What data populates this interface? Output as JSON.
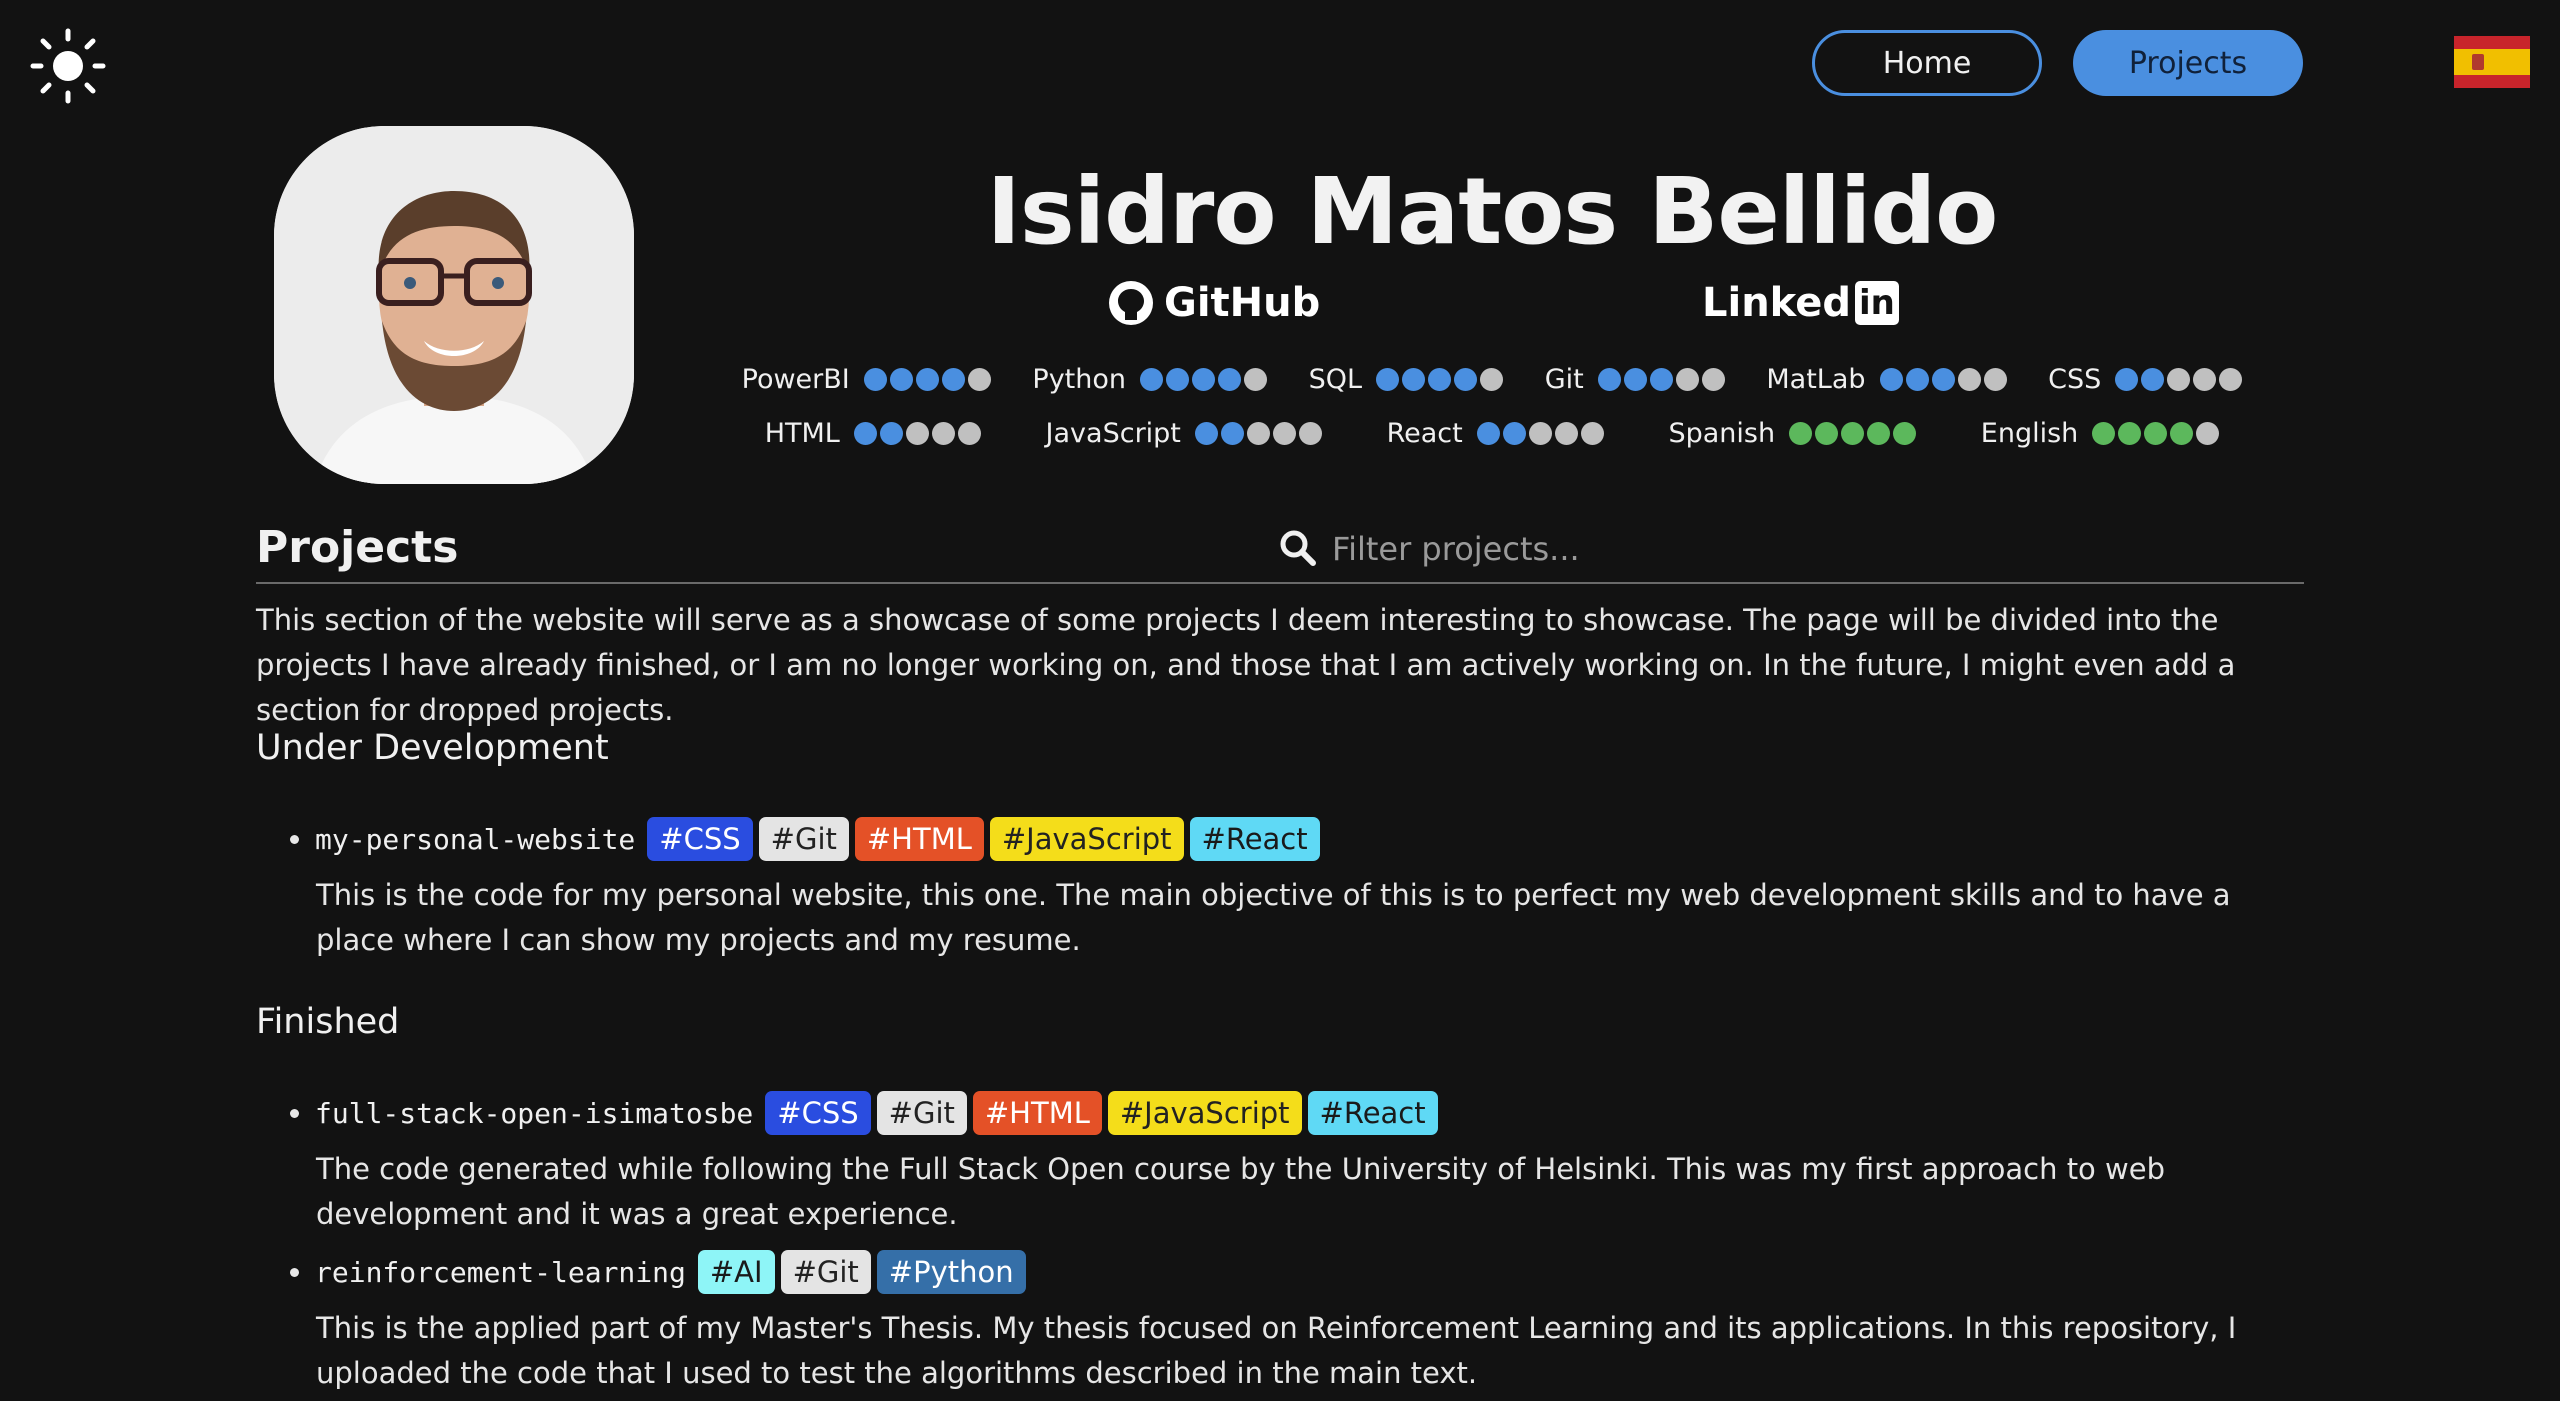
{
  "theme": {
    "icon": "sun-icon"
  },
  "nav": {
    "home_label": "Home",
    "projects_label": "Projects"
  },
  "language_flag": {
    "icon": "spain-flag-icon"
  },
  "profile": {
    "name": "Isidro Matos Bellido",
    "github_label": "GitHub",
    "linkedin_label": "Linked",
    "linkedin_box": "in"
  },
  "skills": {
    "row1": [
      {
        "name": "PowerBI",
        "level": 4,
        "max": 5,
        "color": "blue"
      },
      {
        "name": "Python",
        "level": 4,
        "max": 5,
        "color": "blue"
      },
      {
        "name": "SQL",
        "level": 4,
        "max": 5,
        "color": "blue"
      },
      {
        "name": "Git",
        "level": 3,
        "max": 5,
        "color": "blue"
      },
      {
        "name": "MatLab",
        "level": 3,
        "max": 5,
        "color": "blue"
      },
      {
        "name": "CSS",
        "level": 2,
        "max": 5,
        "color": "blue"
      }
    ],
    "row2": [
      {
        "name": "HTML",
        "level": 2,
        "max": 5,
        "color": "blue"
      },
      {
        "name": "JavaScript",
        "level": 2,
        "max": 5,
        "color": "blue"
      },
      {
        "name": "React",
        "level": 2,
        "max": 5,
        "color": "blue"
      },
      {
        "name": "Spanish",
        "level": 5,
        "max": 5,
        "color": "green"
      },
      {
        "name": "English",
        "level": 4,
        "max": 5,
        "color": "green"
      }
    ]
  },
  "projects_section": {
    "title": "Projects",
    "search_placeholder": "Filter projects...",
    "intro": "This section of the website will serve as a showcase of some projects I deem interesting to showcase. The page will be divided into the projects I have already finished, or I am no longer working on, and those that I am actively working on. In the future, I might even add a section for dropped projects.",
    "under_development_title": "Under Development",
    "finished_title": "Finished"
  },
  "tag_colors": {
    "#CSS": {
      "bg": "#2a4de0",
      "fg": "#ffffff"
    },
    "#Git": {
      "bg": "#e4e4e4",
      "fg": "#222222"
    },
    "#HTML": {
      "bg": "#e45127",
      "fg": "#ffffff"
    },
    "#JavaScript": {
      "bg": "#f4dd1a",
      "fg": "#222222"
    },
    "#React": {
      "bg": "#5fd9f5",
      "fg": "#1a1a1a"
    },
    "#AI": {
      "bg": "#8ef5f7",
      "fg": "#1a1a1a"
    },
    "#Python": {
      "bg": "#356fa8",
      "fg": "#ffffff"
    }
  },
  "under_development": [
    {
      "name": "my-personal-website",
      "tags": [
        "#CSS",
        "#Git",
        "#HTML",
        "#JavaScript",
        "#React"
      ],
      "description": "This is the code for my personal website, this one. The main objective of this is to perfect my web development skills and to have a place where I can show my projects and my resume."
    }
  ],
  "finished": [
    {
      "name": "full-stack-open-isimatosbe",
      "tags": [
        "#CSS",
        "#Git",
        "#HTML",
        "#JavaScript",
        "#React"
      ],
      "description": "The code generated while following the Full Stack Open course by the University of Helsinki. This was my first approach to web development and it was a great experience."
    },
    {
      "name": "reinforcement-learning",
      "tags": [
        "#AI",
        "#Git",
        "#Python"
      ],
      "description": "This is the applied part of my Master's Thesis. My thesis focused on Reinforcement Learning and its applications. In this repository, I uploaded the code that I used to test the algorithms described in the main text."
    }
  ]
}
